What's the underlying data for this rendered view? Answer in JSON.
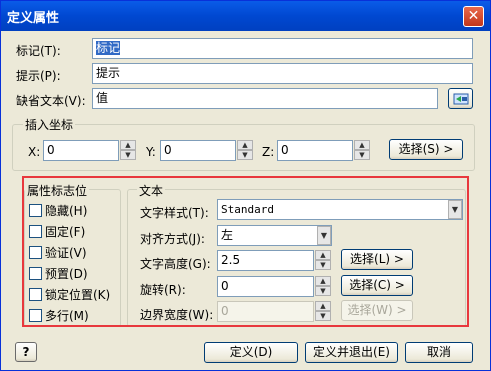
{
  "window": {
    "title": "定义属性",
    "close_glyph": "✕"
  },
  "fields": {
    "tag": {
      "label": "标记(T):",
      "value": "标记"
    },
    "prompt": {
      "label": "提示(P):",
      "value": "提示"
    },
    "default": {
      "label": "缺省文本(V):",
      "value": "值"
    }
  },
  "insert": {
    "title": "插入坐标",
    "x_label": "X:",
    "x_value": "0",
    "y_label": "Y:",
    "y_value": "0",
    "z_label": "Z:",
    "z_value": "0",
    "select_button": "选择(S) >"
  },
  "flags": {
    "title": "属性标志位",
    "items": [
      {
        "label": "隐藏(H)",
        "checked": false
      },
      {
        "label": "固定(F)",
        "checked": false
      },
      {
        "label": "验证(V)",
        "checked": false
      },
      {
        "label": "预置(D)",
        "checked": false
      },
      {
        "label": "锁定位置(K)",
        "checked": false
      },
      {
        "label": "多行(M)",
        "checked": false
      }
    ]
  },
  "text": {
    "title": "文本",
    "style_label": "文字样式(T):",
    "style_value": "Standard",
    "align_label": "对齐方式(J):",
    "align_value": "左",
    "height_label": "文字高度(G):",
    "height_value": "2.5",
    "height_button": "选择(L) >",
    "rotation_label": "旋转(R):",
    "rotation_value": "0",
    "rotation_button": "选择(C) >",
    "width_label": "边界宽度(W):",
    "width_value": "0",
    "width_button": "选择(W) >"
  },
  "buttons": {
    "ok": "定义(D)",
    "ok_exit": "定义并退出(E)",
    "cancel": "取消",
    "help": "?"
  },
  "colors": {
    "titlebar": "#0048d1",
    "highlight": "#e8383d",
    "selection": "#316ac5"
  }
}
